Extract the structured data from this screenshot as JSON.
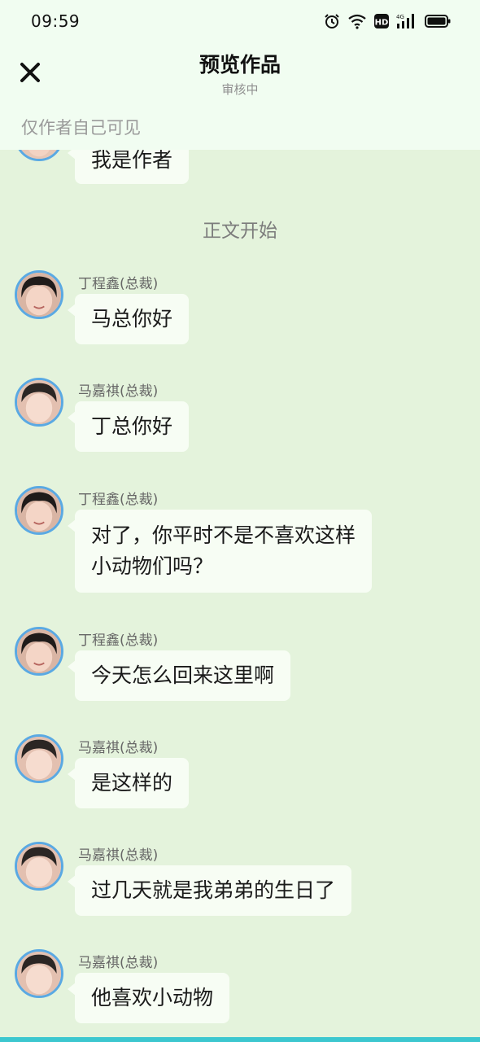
{
  "status_bar": {
    "time": "09:59",
    "network": "4G",
    "hd": "HD"
  },
  "header": {
    "title": "预览作品",
    "subtitle": "审核中",
    "visibility_note": "仅作者自己可见"
  },
  "intro": {
    "author_message": "我是作者"
  },
  "divider": "正文开始",
  "messages": [
    {
      "sender": "丁程鑫(总裁)",
      "text": "马总你好"
    },
    {
      "sender": "马嘉祺(总裁)",
      "text": "丁总你好"
    },
    {
      "sender": "丁程鑫(总裁)",
      "text": "对了，你平时不是不喜欢这样",
      "text2": "小动物们吗？"
    },
    {
      "sender": "丁程鑫(总裁)",
      "text": "今天怎么回来这里啊"
    },
    {
      "sender": "马嘉祺(总裁)",
      "text": "是这样的"
    },
    {
      "sender": "马嘉祺(总裁)",
      "text": "过几天就是我弟弟的生日了"
    },
    {
      "sender": "马嘉祺(总裁)",
      "text": "他喜欢小动物"
    }
  ],
  "icons": {
    "close": "close-icon",
    "alarm": "alarm-icon",
    "wifi": "wifi-icon",
    "signal": "signal-icon",
    "battery": "battery-icon"
  },
  "colors": {
    "chat_background": "#e4f3dc",
    "header_background": "#f1fdf1",
    "bubble": "#f7fdf4",
    "avatar_border": "#5aa9e3",
    "bottom_accent": "#3cc7cf"
  }
}
